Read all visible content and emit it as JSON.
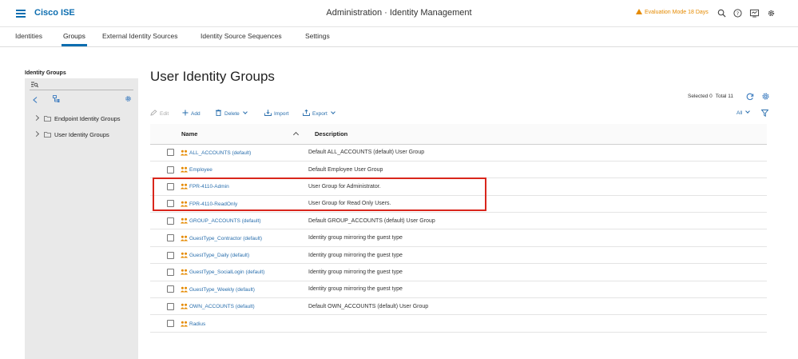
{
  "header": {
    "brand": "Cisco ISE",
    "title": "Administration · Identity Management",
    "eval_mode": "Evaluation Mode 18 Days",
    "icons": [
      "search-icon",
      "help-icon",
      "notifications-icon",
      "settings-icon"
    ]
  },
  "tabs": [
    {
      "label": "Identities"
    },
    {
      "label": "Groups",
      "active": true
    },
    {
      "label": "External Identity Sources"
    },
    {
      "label": "Identity Source Sequences"
    },
    {
      "label": "Settings"
    }
  ],
  "sidebar": {
    "title": "Identity Groups",
    "items": [
      {
        "label": "Endpoint Identity Groups"
      },
      {
        "label": "User Identity Groups"
      }
    ]
  },
  "main": {
    "title": "User Identity Groups",
    "selected_label": "Selected 0",
    "total_label": "Total 11",
    "toolbar": {
      "edit": "Edit",
      "add": "Add",
      "delete": "Delete",
      "import": "Import",
      "export": "Export",
      "filter_all": "All"
    },
    "columns": {
      "name": "Name",
      "description": "Description"
    },
    "rows": [
      {
        "name": "ALL_ACCOUNTS (default)",
        "description": "Default ALL_ACCOUNTS (default) User Group"
      },
      {
        "name": "Employee",
        "description": "Default Employee User Group"
      },
      {
        "name": "FPR-4110-Admin",
        "description": "User Group for Administrator."
      },
      {
        "name": "FPR-4110-ReadOnly",
        "description": "User Group for Read Only Users."
      },
      {
        "name": "GROUP_ACCOUNTS (default)",
        "description": "Default GROUP_ACCOUNTS (default) User Group"
      },
      {
        "name": "GuestType_Contractor (default)",
        "description": "Identity group mirroring the guest type"
      },
      {
        "name": "GuestType_Daily (default)",
        "description": "Identity group mirroring the guest type"
      },
      {
        "name": "GuestType_SocialLogin (default)",
        "description": "Identity group mirroring the guest type"
      },
      {
        "name": "GuestType_Weekly (default)",
        "description": "Identity group mirroring the guest type"
      },
      {
        "name": "OWN_ACCOUNTS (default)",
        "description": "Default OWN_ACCOUNTS (default) User Group"
      },
      {
        "name": "Radius",
        "description": ""
      }
    ]
  },
  "colors": {
    "accent": "#0d6eb0",
    "link": "#2a6fad",
    "warning": "#e58a00",
    "highlight": "#d9261c"
  }
}
